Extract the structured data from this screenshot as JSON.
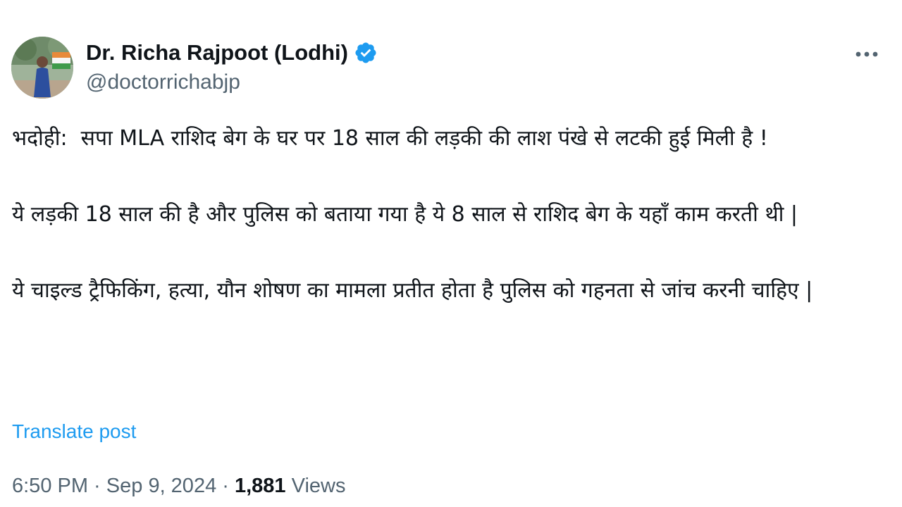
{
  "author": {
    "display_name": "Dr. Richa Rajpoot (Lodhi)",
    "handle": "@doctorrichabjp",
    "verified": true,
    "verified_icon": "verified-badge-icon",
    "verified_color": "#1d9bf0"
  },
  "post": {
    "paragraphs": [
      "भदोही:  सपा MLA राशिद बेग के घर पर 18 साल की लड़की की लाश पंखे से लटकी हुई मिली है !",
      "ये लड़की 18 साल की है और पुलिस को बताया गया है ये 8 साल से राशिद बेग के यहाँ काम करती थी |",
      "ये चाइल्ड ट्रैफिकिंग, हत्या, यौन शोषण का मामला प्रतीत होता है पुलिस को गहनता से जांच करनी चाहिए |"
    ],
    "translate_label": "Translate post"
  },
  "meta": {
    "time": "6:50 PM",
    "separator": " · ",
    "date": "Sep 9, 2024",
    "views_count": "1,881",
    "views_label": " Views"
  },
  "more_icon": "more-horizontal-icon",
  "colors": {
    "text": "#0f1419",
    "secondary": "#536471",
    "link": "#1d9bf0"
  }
}
